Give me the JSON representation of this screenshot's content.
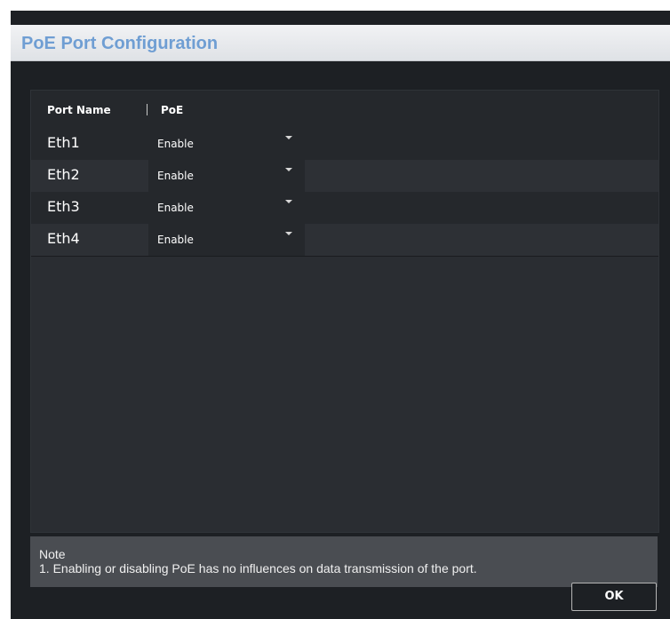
{
  "dialog": {
    "title": "PoE Port Configuration"
  },
  "table": {
    "columns": [
      "Port Name",
      "PoE"
    ],
    "rows": [
      {
        "port": "Eth1",
        "poe": "Enable"
      },
      {
        "port": "Eth2",
        "poe": "Enable"
      },
      {
        "port": "Eth3",
        "poe": "Enable"
      },
      {
        "port": "Eth4",
        "poe": "Enable"
      }
    ]
  },
  "note": {
    "title": "Note",
    "text": "1. Enabling or disabling PoE has no influences on data transmission of the port."
  },
  "buttons": {
    "ok": "OK"
  },
  "icons": {
    "dropdown": "chevron-down-icon"
  },
  "colors": {
    "title_text": "#6f9ed3",
    "dialog_bg": "#1d2024",
    "panel_bg": "#2a2d32"
  }
}
